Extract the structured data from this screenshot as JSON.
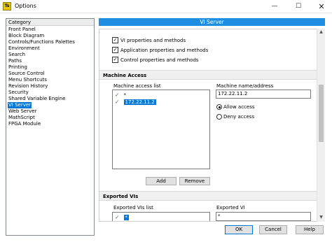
{
  "window": {
    "title": "Options",
    "app_icon_text": "Ts"
  },
  "sidebar": {
    "header": "Category",
    "items": [
      {
        "label": "Front Panel",
        "selected": false
      },
      {
        "label": "Block Diagram",
        "selected": false
      },
      {
        "label": "Controls/Functions Palettes",
        "selected": false
      },
      {
        "label": "Environment",
        "selected": false
      },
      {
        "label": "Search",
        "selected": false
      },
      {
        "label": "Paths",
        "selected": false
      },
      {
        "label": "Printing",
        "selected": false
      },
      {
        "label": "Source Control",
        "selected": false
      },
      {
        "label": "Menu Shortcuts",
        "selected": false
      },
      {
        "label": "Revision History",
        "selected": false
      },
      {
        "label": "Security",
        "selected": false
      },
      {
        "label": "Shared Variable Engine",
        "selected": false
      },
      {
        "label": "VI Server",
        "selected": true
      },
      {
        "label": "Web Server",
        "selected": false
      },
      {
        "label": "MathScript",
        "selected": false
      },
      {
        "label": "FPGA Module",
        "selected": false
      }
    ]
  },
  "panel": {
    "title": "VI Server",
    "checkboxes": [
      {
        "label": "VI properties and methods",
        "checked": true
      },
      {
        "label": "Application properties and methods",
        "checked": true
      },
      {
        "label": "Control properties and methods",
        "checked": true
      }
    ],
    "machine_access": {
      "section_title": "Machine Access",
      "list_label": "Machine access list",
      "entries": [
        {
          "mark": "✓",
          "text": "*",
          "selected": false
        },
        {
          "mark": "✓",
          "text": "172.22.11.2",
          "selected": true
        }
      ],
      "name_label": "Machine name/address",
      "name_value": "172.22.11.2",
      "radio_allow": "Allow access",
      "radio_deny": "Deny access",
      "allow_selected": true,
      "add_label": "Add",
      "remove_label": "Remove"
    },
    "exported_vis": {
      "section_title": "Exported VIs",
      "list_label": "Exported VIs list",
      "entries": [
        {
          "mark": "✓",
          "text": "*",
          "selected": true
        }
      ],
      "vi_label": "Exported VI",
      "vi_value": "*"
    }
  },
  "footer": {
    "ok_label": "OK",
    "cancel_label": "Cancel",
    "help_label": "Help"
  },
  "colors": {
    "accent": "#0078d7",
    "header_blue": "#1e8ee3",
    "check_green": "#1b8a1b"
  }
}
